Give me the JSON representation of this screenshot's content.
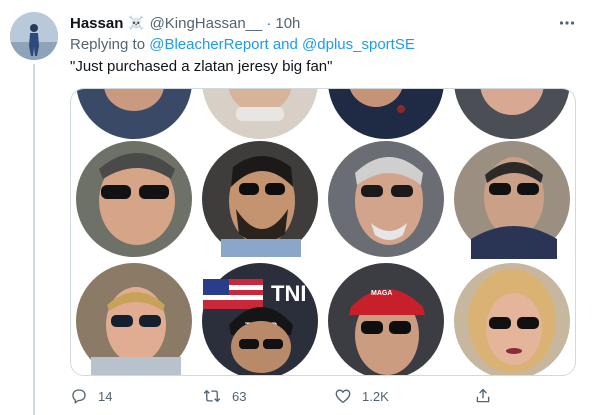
{
  "tweet": {
    "display_name": "Hassan",
    "name_emoji": "☠️",
    "handle": "@KingHassan__",
    "separator": "·",
    "time": "10h",
    "replying_to_prefix": "Replying to",
    "replying_to_mention_1": "@BleacherReport",
    "replying_to_joiner": "and",
    "replying_to_mention_2": "@dplus_sportSE",
    "text": "\"Just purchased a zlatan jeresy big fan\"",
    "media_description_icon": "photo-grid-of-selfies",
    "actions": {
      "reply_count": "14",
      "retweet_count": "63",
      "like_count": "1.2K"
    }
  },
  "colors": {
    "link": "#1d9bf0",
    "secondary_text": "#536471",
    "border": "#cfd9de"
  },
  "icons": [
    "skull-crossbones-icon",
    "more-icon",
    "reply-icon",
    "retweet-icon",
    "like-icon",
    "share-icon"
  ]
}
